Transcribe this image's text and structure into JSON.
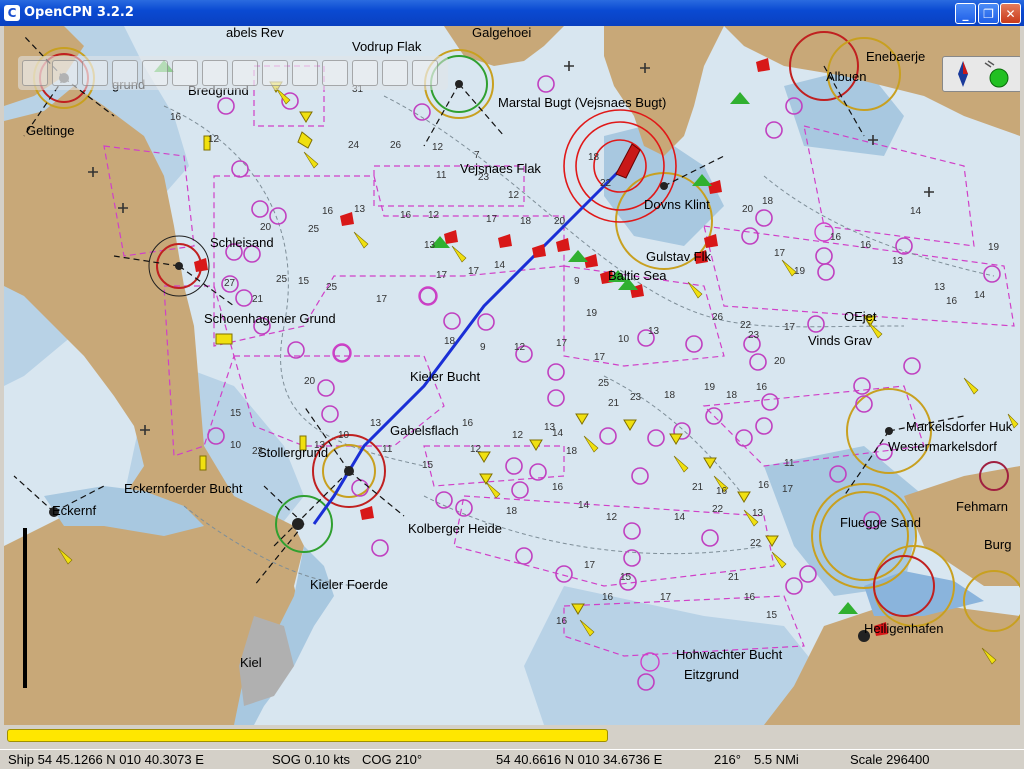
{
  "window": {
    "title": "OpenCPN 3.2.2",
    "app_icon": "C",
    "buttons": {
      "minimize": "_",
      "maximize": "❐",
      "close": "✕"
    }
  },
  "colors": {
    "land": "#c8a878",
    "deep_water": "#d8e6f0",
    "shallow_water": "#a8c8e0",
    "very_shallow": "#8ab4dc",
    "route": "#1a2fd6",
    "titlebar": "#0a4ad2",
    "progress": "#ffe700"
  },
  "places": [
    {
      "id": "geltinge",
      "label": "Geltinge"
    },
    {
      "id": "bredgrund",
      "label": "Bredgrund"
    },
    {
      "id": "kalkgrund",
      "label": "grund"
    },
    {
      "id": "galgehoei",
      "label": "Galgehoei"
    },
    {
      "id": "gabels-rev",
      "label": "abels Rev"
    },
    {
      "id": "vodrup",
      "label": "Vodrup Flak"
    },
    {
      "id": "marstal",
      "label": "Marstal Bugt (Vejsnaes Bugt)"
    },
    {
      "id": "vejsnaes",
      "label": "Vejsnaes Flak"
    },
    {
      "id": "dovns",
      "label": "Dovns Klint"
    },
    {
      "id": "enebaer",
      "label": "Enebaerje"
    },
    {
      "id": "albuen",
      "label": "Albuen"
    },
    {
      "id": "schleisand",
      "label": "Schleisand"
    },
    {
      "id": "gulstav",
      "label": "Gulstav Flk"
    },
    {
      "id": "baltic",
      "label": "Baltic Sea"
    },
    {
      "id": "schoenhagener",
      "label": "Schoenhagener Grund"
    },
    {
      "id": "kieler-bucht",
      "label": "Kieler Bucht"
    },
    {
      "id": "oejet",
      "label": "OEjet"
    },
    {
      "id": "vinds",
      "label": "Vinds Grav"
    },
    {
      "id": "gabelsflach",
      "label": "Gabelsflach"
    },
    {
      "id": "stollergrund",
      "label": "Stollergrund"
    },
    {
      "id": "markelsdorfer",
      "label": "Markelsdorfer Huk"
    },
    {
      "id": "westermark",
      "label": "Westermarkelsdorf"
    },
    {
      "id": "eckernfoerder",
      "label": "Eckernfoerder Bucht"
    },
    {
      "id": "eckernf",
      "label": "Eckernf"
    },
    {
      "id": "kolberger",
      "label": "Kolberger Heide"
    },
    {
      "id": "fehmarn",
      "label": "Fehmarn"
    },
    {
      "id": "flugge",
      "label": "Fluegge Sand"
    },
    {
      "id": "burg",
      "label": "Burg"
    },
    {
      "id": "kieler-foerde",
      "label": "Kieler Foerde"
    },
    {
      "id": "heiligenhafen",
      "label": "Heiligenhafen"
    },
    {
      "id": "kiel",
      "label": "Kiel"
    },
    {
      "id": "hohwachter",
      "label": "Hohwachter Bucht"
    },
    {
      "id": "eitzgrund",
      "label": "Eitzgrund"
    }
  ],
  "depths": [
    "31",
    "16",
    "12",
    "24",
    "26",
    "12",
    "7",
    "11",
    "23",
    "12",
    "16",
    "13",
    "16",
    "12",
    "17",
    "18",
    "20",
    "22",
    "18",
    "25",
    "20",
    "13",
    "14",
    "17",
    "17",
    "9",
    "27",
    "25",
    "15",
    "25",
    "21",
    "17",
    "19",
    "10",
    "13",
    "18",
    "9",
    "12",
    "17",
    "17",
    "25",
    "21",
    "23",
    "18",
    "19",
    "18",
    "16",
    "20",
    "23",
    "17",
    "14",
    "13",
    "13",
    "16",
    "14",
    "19",
    "20",
    "18",
    "17",
    "19",
    "16",
    "16",
    "26",
    "22",
    "22",
    "20",
    "15",
    "10",
    "13",
    "13",
    "10",
    "11",
    "15",
    "12",
    "12",
    "14",
    "18",
    "13",
    "16",
    "18",
    "16",
    "14",
    "12",
    "17",
    "14",
    "16",
    "21",
    "22",
    "16",
    "17",
    "11",
    "13",
    "22",
    "15",
    "16",
    "17",
    "16",
    "21",
    "16",
    "15"
  ],
  "status": {
    "ship": "Ship 54 45.1266 N   010 40.3073 E",
    "sog": "SOG 0.10 kts",
    "cog": "COG 210°",
    "cursor": "54 40.6616 N   010 34.6736 E",
    "bearing": "216°",
    "distance": "5.5 NMi",
    "scale": "Scale 296400"
  },
  "progress": {
    "fraction": 0.595
  },
  "toolbar": {
    "icons": [
      "zoom-in-icon",
      "zoom-out-icon",
      "scale-icon",
      "chart-icon",
      "route-icon",
      "track-icon",
      "waypoint-icon",
      "tide-icon",
      "current-icon",
      "settings-icon",
      "ais-icon",
      "print-icon",
      "info-icon",
      "help-icon"
    ]
  },
  "compass": {
    "icons": [
      "compass-rose-icon",
      "gps-status-icon"
    ]
  }
}
